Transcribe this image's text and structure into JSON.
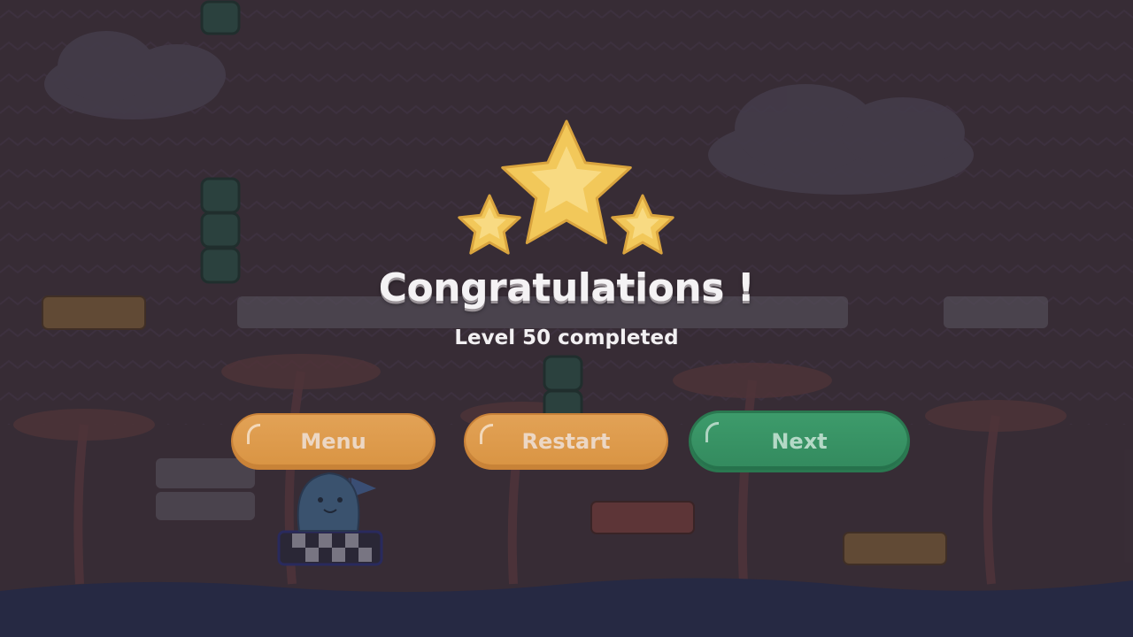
{
  "dialog": {
    "title": "Congratulations !",
    "subtitle": "Level 50 completed",
    "stars_earned": 3,
    "stars_total": 3
  },
  "buttons": {
    "menu": "Menu",
    "restart": "Restart",
    "next": "Next"
  },
  "colors": {
    "star_fill": "#f2c85a",
    "button_orange": "#dc9a4a",
    "button_green": "#3a956a",
    "background": "#3b3039",
    "water": "#272c4a"
  },
  "icons": [
    "star-icon",
    "player-blob-character",
    "goal-flag-icon"
  ]
}
